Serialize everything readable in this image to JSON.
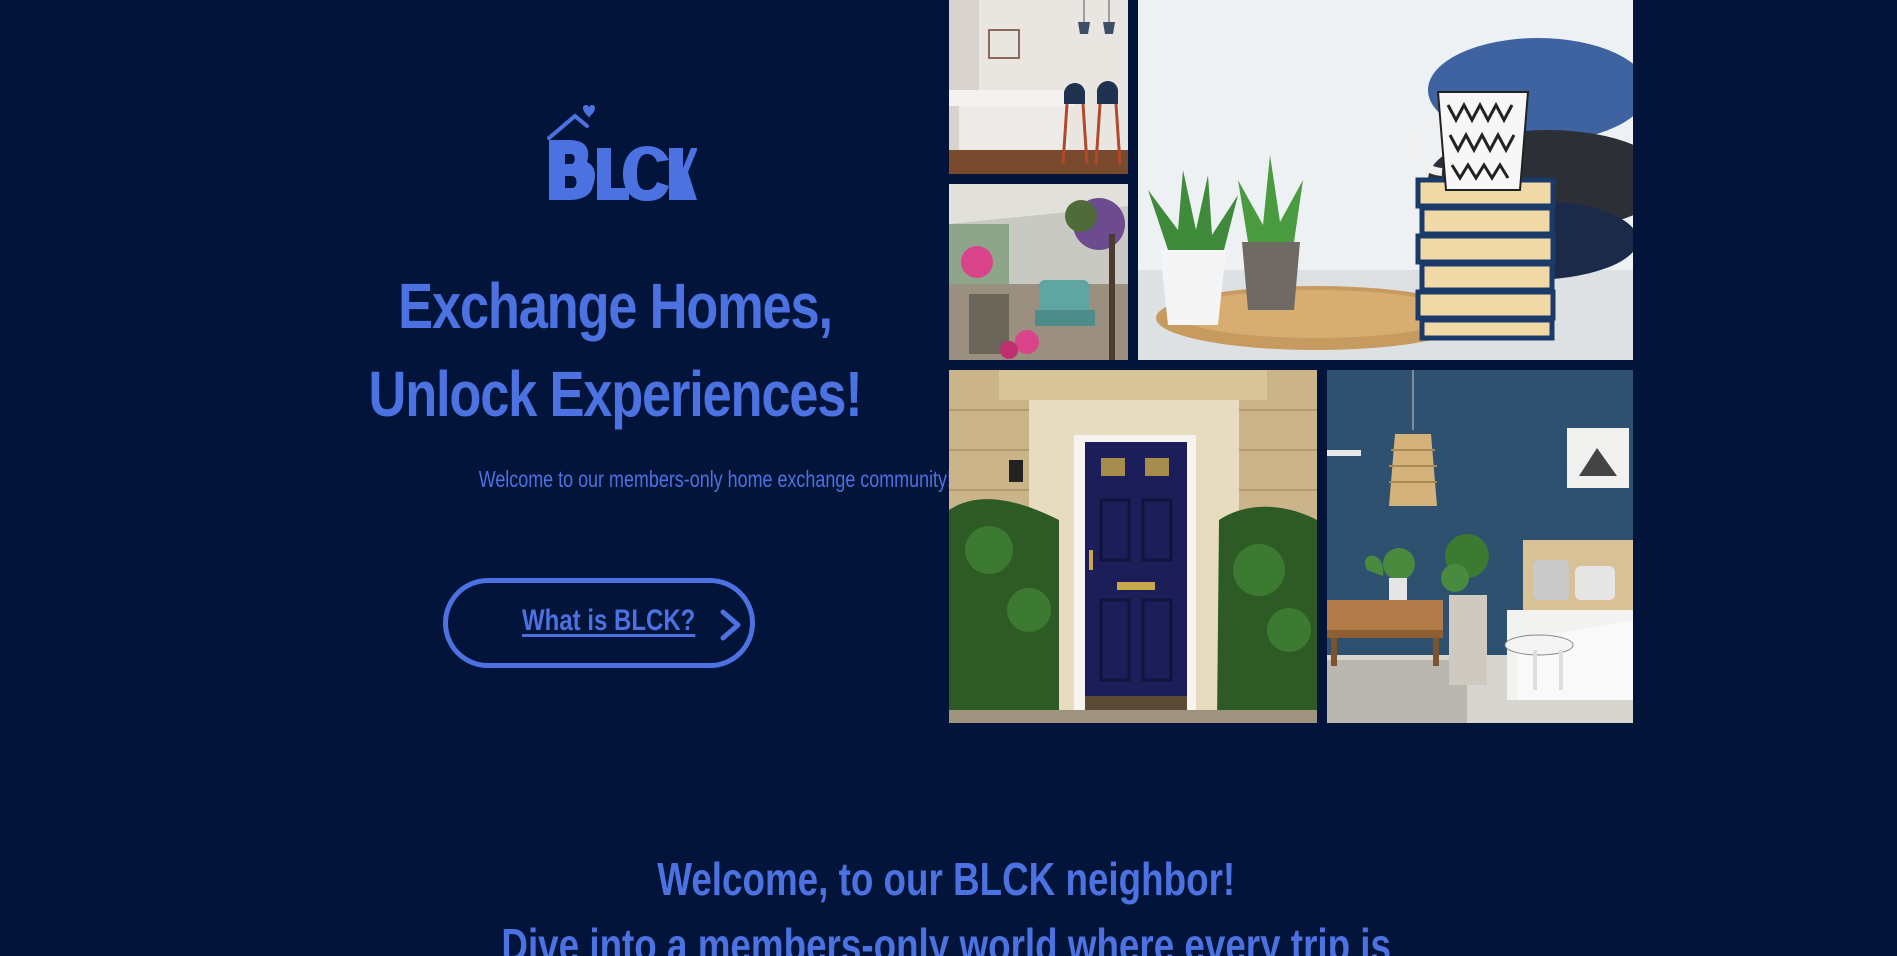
{
  "brand": {
    "logo_text": "BLCK",
    "accent_color": "#4b72e0",
    "background_color": "#02143a"
  },
  "hero": {
    "headline_line1": "Exchange Homes,",
    "headline_line2": "Unlock Experiences!",
    "subtitle": "Welcome to our members-only home exchange community!",
    "cta_label": "What is BLCK?",
    "cta_icon": "chevron-right-icon"
  },
  "collage": {
    "images": [
      "kitchen-with-bar-stools",
      "balcony-with-flowers",
      "succulents-mug-and-books",
      "navy-front-door",
      "blue-bedroom"
    ]
  },
  "welcome": {
    "heading": "Welcome, to our BLCK neighbor!",
    "subheading": "Dive into a members-only world where every trip is"
  }
}
